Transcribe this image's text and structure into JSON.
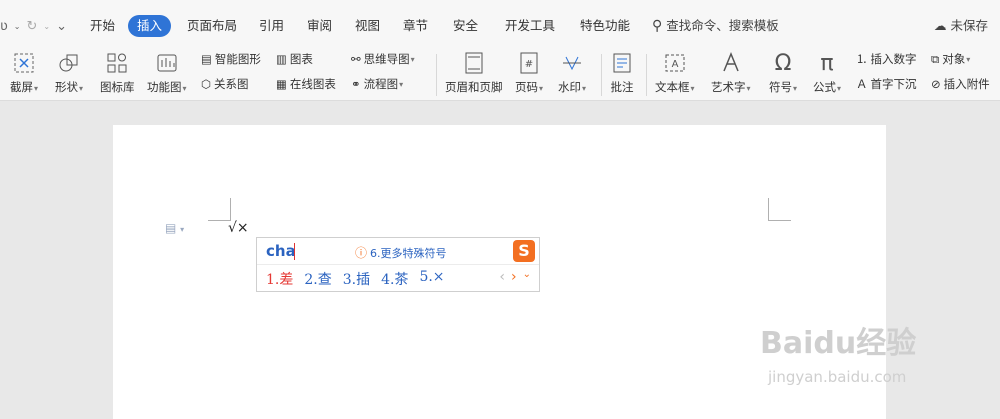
{
  "quick_access": {
    "redo": "↻",
    "more": "⌄"
  },
  "menu": {
    "tabs": [
      "开始",
      "插入",
      "页面布局",
      "引用",
      "审阅",
      "视图",
      "章节",
      "安全",
      "开发工具",
      "特色功能"
    ],
    "active": "插入",
    "search": "查找命令、搜索模板",
    "unsaved": "未保存"
  },
  "ribbon": {
    "screenshot": "截屏",
    "shapes": "形状",
    "iconlib": "图标库",
    "funcchart": "功能图",
    "smartart": "智能图形",
    "chart": "图表",
    "relation": "关系图",
    "onlinechart": "在线图表",
    "mindmap": "思维导图",
    "flowchart": "流程图",
    "headerfooter": "页眉和页脚",
    "pagenum": "页码",
    "watermark": "水印",
    "comment": "批注",
    "textbox": "文本框",
    "wordart": "艺术字",
    "symbol": "符号",
    "formula": "公式",
    "insertnum": "插入数字",
    "object": "对象",
    "dropcap": "首字下沉",
    "attachment": "插入附件"
  },
  "document": {
    "typed": "√×"
  },
  "ime": {
    "pinyin": "cha",
    "more_symbols": "6.更多特殊符号",
    "candidates": [
      "1.差",
      "2.查",
      "3.插",
      "4.茶",
      "5.×"
    ]
  },
  "watermark": {
    "brand": "Baidu经验",
    "url": "jingyan.baidu.com"
  }
}
